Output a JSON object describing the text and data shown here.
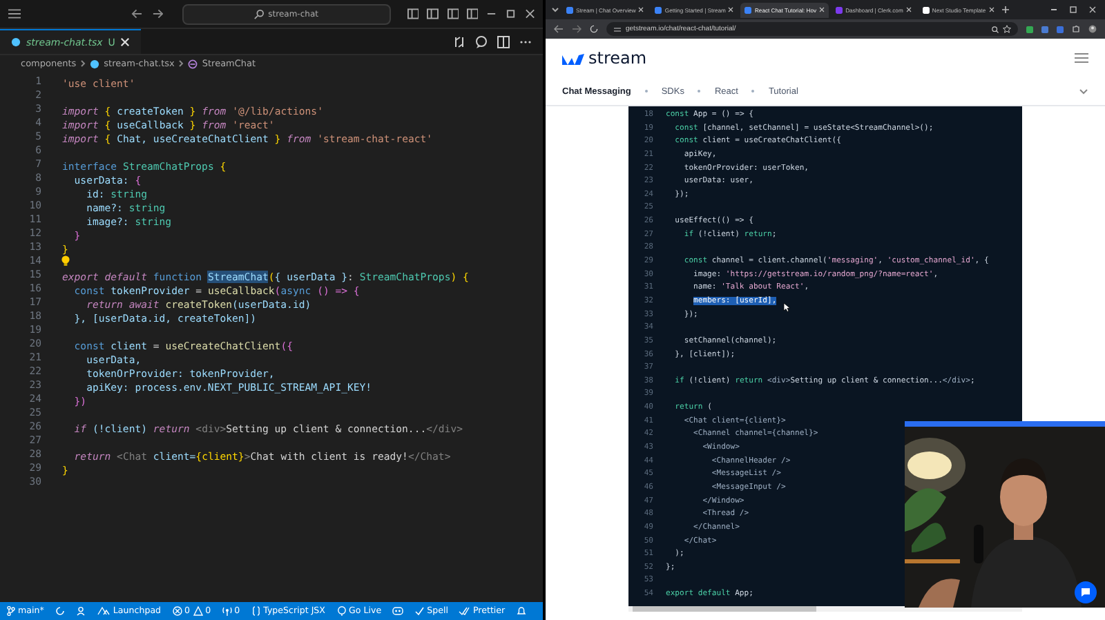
{
  "editor": {
    "search": "stream-chat",
    "tab": {
      "name": "stream-chat.tsx",
      "status": "U"
    },
    "breadcrumbs": [
      "components",
      "stream-chat.tsx",
      "StreamChat"
    ],
    "lines": [
      {
        "number": "1",
        "tokens": [
          {
            "text": "'use client'",
            "kind": "str"
          }
        ]
      },
      {
        "number": "2"
      },
      {
        "number": "3",
        "tokens": [
          {
            "text": "import ",
            "kind": "kw"
          },
          {
            "text": "{",
            "kind": "brace"
          },
          {
            "text": " createToken ",
            "kind": "var"
          },
          {
            "text": "}",
            "kind": "brace"
          },
          {
            "text": " from ",
            "kind": "kw"
          },
          {
            "text": "'@/lib/actions'",
            "kind": "str"
          }
        ]
      },
      {
        "number": "4",
        "tokens": [
          {
            "text": "import ",
            "kind": "kw"
          },
          {
            "text": "{",
            "kind": "brace"
          },
          {
            "text": " useCallback ",
            "kind": "var"
          },
          {
            "text": "}",
            "kind": "brace"
          },
          {
            "text": " from ",
            "kind": "kw"
          },
          {
            "text": "'react'",
            "kind": "str"
          }
        ]
      },
      {
        "number": "5",
        "tokens": [
          {
            "text": "import ",
            "kind": "kw"
          },
          {
            "text": "{",
            "kind": "brace"
          },
          {
            "text": " Chat, useCreateChatClient ",
            "kind": "var"
          },
          {
            "text": "}",
            "kind": "brace"
          },
          {
            "text": " from ",
            "kind": "kw"
          },
          {
            "text": "'stream-chat-react'",
            "kind": "str"
          }
        ]
      },
      {
        "number": "6"
      },
      {
        "number": "7",
        "tokens": [
          {
            "text": "interface ",
            "kind": "decl"
          },
          {
            "text": "StreamChatProps ",
            "kind": "type"
          },
          {
            "text": "{",
            "kind": "brace"
          }
        ]
      },
      {
        "number": "8",
        "tokens": [
          {
            "text": "  userData: ",
            "kind": "var"
          },
          {
            "text": "{",
            "kind": "brace2"
          }
        ]
      },
      {
        "number": "9",
        "tokens": [
          {
            "text": "    id: ",
            "kind": "var"
          },
          {
            "text": "string",
            "kind": "type"
          }
        ]
      },
      {
        "number": "10",
        "tokens": [
          {
            "text": "    name?: ",
            "kind": "var"
          },
          {
            "text": "string",
            "kind": "type"
          }
        ]
      },
      {
        "number": "11",
        "tokens": [
          {
            "text": "    image?: ",
            "kind": "var"
          },
          {
            "text": "string",
            "kind": "type"
          }
        ]
      },
      {
        "number": "12",
        "tokens": [
          {
            "text": "  }",
            "kind": "brace2"
          }
        ]
      },
      {
        "number": "13",
        "tokens": [
          {
            "text": "}",
            "kind": "brace"
          }
        ]
      },
      {
        "number": "14"
      },
      {
        "number": "15",
        "tokens": [
          {
            "text": "export default ",
            "kind": "kw"
          },
          {
            "text": "function ",
            "kind": "decl"
          },
          {
            "text": "StreamChat",
            "kind": "sel"
          },
          {
            "text": "(",
            "kind": "brace"
          },
          {
            "text": "{ userData }",
            "kind": "var"
          },
          {
            "text": ": ",
            "kind": "punct"
          },
          {
            "text": "StreamChatProps",
            "kind": "type"
          },
          {
            "text": ") {",
            "kind": "brace"
          }
        ]
      },
      {
        "number": "16",
        "tokens": [
          {
            "text": "  const ",
            "kind": "decl"
          },
          {
            "text": "tokenProvider ",
            "kind": "var"
          },
          {
            "text": "= ",
            "kind": "punct"
          },
          {
            "text": "useCallback",
            "kind": "fn"
          },
          {
            "text": "(",
            "kind": "brace2"
          },
          {
            "text": "async ",
            "kind": "decl"
          },
          {
            "text": "() => {",
            "kind": "brace2"
          }
        ]
      },
      {
        "number": "17",
        "tokens": [
          {
            "text": "    return await ",
            "kind": "kw"
          },
          {
            "text": "createToken",
            "kind": "fn"
          },
          {
            "text": "(userData.id)",
            "kind": "var"
          }
        ]
      },
      {
        "number": "18",
        "tokens": [
          {
            "text": "  }, [userData.id, createToken])",
            "kind": "var"
          }
        ]
      },
      {
        "number": "19"
      },
      {
        "number": "20",
        "tokens": [
          {
            "text": "  const ",
            "kind": "decl"
          },
          {
            "text": "client ",
            "kind": "var"
          },
          {
            "text": "= ",
            "kind": "punct"
          },
          {
            "text": "useCreateChatClient",
            "kind": "fn"
          },
          {
            "text": "({",
            "kind": "brace2"
          }
        ]
      },
      {
        "number": "21",
        "tokens": [
          {
            "text": "    userData,",
            "kind": "var"
          }
        ]
      },
      {
        "number": "22",
        "tokens": [
          {
            "text": "    tokenOrProvider: tokenProvider,",
            "kind": "var"
          }
        ]
      },
      {
        "number": "23",
        "tokens": [
          {
            "text": "    apiKey: process.env.NEXT_PUBLIC_STREAM_API_KEY!",
            "kind": "var"
          }
        ]
      },
      {
        "number": "24",
        "tokens": [
          {
            "text": "  })",
            "kind": "brace2"
          }
        ]
      },
      {
        "number": "25"
      },
      {
        "number": "26",
        "tokens": [
          {
            "text": "  if ",
            "kind": "kw"
          },
          {
            "text": "(!client) ",
            "kind": "var"
          },
          {
            "text": "return ",
            "kind": "kw"
          },
          {
            "text": "<div>",
            "kind": "tag"
          },
          {
            "text": "Setting up client & connection...",
            "kind": "punct"
          },
          {
            "text": "</div>",
            "kind": "tag"
          }
        ]
      },
      {
        "number": "27"
      },
      {
        "number": "28",
        "tokens": [
          {
            "text": "  return ",
            "kind": "kw"
          },
          {
            "text": "<Chat ",
            "kind": "tag"
          },
          {
            "text": "client=",
            "kind": "var"
          },
          {
            "text": "{client}",
            "kind": "brace"
          },
          {
            "text": ">",
            "kind": "tag"
          },
          {
            "text": "Chat with client is ready!",
            "kind": "punct"
          },
          {
            "text": "</Chat>",
            "kind": "tag"
          }
        ]
      },
      {
        "number": "29",
        "tokens": [
          {
            "text": "}",
            "kind": "brace"
          }
        ]
      },
      {
        "number": "30"
      }
    ]
  },
  "status_bar": {
    "branch": "main*",
    "launchpad": "Launchpad",
    "errors": "0",
    "warnings": "0",
    "ports": "0",
    "language": "TypeScript JSX",
    "go_live": "Go Live",
    "spell": "Spell",
    "prettier": "Prettier"
  },
  "browser": {
    "tabs": [
      {
        "title": "Stream | Chat Overview",
        "selected": false
      },
      {
        "title": "Getting Started | Stream",
        "selected": false
      },
      {
        "title": "React Chat Tutorial: Hov",
        "selected": true
      },
      {
        "title": "Dashboard | Clerk.com",
        "selected": false
      },
      {
        "title": "Next Studio Template",
        "selected": false
      }
    ],
    "address": "getstream.io/chat/react-chat/tutorial/",
    "logo": "stream",
    "nav": [
      "Chat Messaging",
      "SDKs",
      "React",
      "Tutorial"
    ],
    "code_lines": [
      {
        "number": "18",
        "tokens": [
          {
            "text": "const ",
            "kind": "kw"
          },
          {
            "text": "App = () => {",
            "kind": "plain"
          }
        ]
      },
      {
        "number": "19",
        "tokens": [
          {
            "text": "  const ",
            "kind": "kw"
          },
          {
            "text": "[channel, setChannel] = useState<StreamChannel>();",
            "kind": "plain"
          }
        ]
      },
      {
        "number": "20",
        "tokens": [
          {
            "text": "  const ",
            "kind": "kw"
          },
          {
            "text": "client = useCreateChatClient({",
            "kind": "plain"
          }
        ]
      },
      {
        "number": "21",
        "tokens": [
          {
            "text": "    apiKey,",
            "kind": "plain"
          }
        ]
      },
      {
        "number": "22",
        "tokens": [
          {
            "text": "    tokenOrProvider: userToken,",
            "kind": "plain"
          }
        ]
      },
      {
        "number": "23",
        "tokens": [
          {
            "text": "    userData: user,",
            "kind": "plain"
          }
        ]
      },
      {
        "number": "24",
        "tokens": [
          {
            "text": "  });",
            "kind": "plain"
          }
        ]
      },
      {
        "number": "25"
      },
      {
        "number": "26",
        "tokens": [
          {
            "text": "  useEffect(() => {",
            "kind": "plain"
          }
        ]
      },
      {
        "number": "27",
        "tokens": [
          {
            "text": "    if ",
            "kind": "kw"
          },
          {
            "text": "(!client) ",
            "kind": "plain"
          },
          {
            "text": "return",
            "kind": "kw"
          },
          {
            "text": ";",
            "kind": "plain"
          }
        ]
      },
      {
        "number": "28"
      },
      {
        "number": "29",
        "tokens": [
          {
            "text": "    const ",
            "kind": "kw"
          },
          {
            "text": "channel = client.channel(",
            "kind": "plain"
          },
          {
            "text": "'messaging'",
            "kind": "str"
          },
          {
            "text": ", ",
            "kind": "plain"
          },
          {
            "text": "'custom_channel_id'",
            "kind": "str"
          },
          {
            "text": ", {",
            "kind": "plain"
          }
        ]
      },
      {
        "number": "30",
        "tokens": [
          {
            "text": "      image: ",
            "kind": "plain"
          },
          {
            "text": "'https://getstream.io/random_png/?name=react'",
            "kind": "str"
          },
          {
            "text": ",",
            "kind": "plain"
          }
        ]
      },
      {
        "number": "31",
        "tokens": [
          {
            "text": "      name: ",
            "kind": "plain"
          },
          {
            "text": "'Talk about React'",
            "kind": "str"
          },
          {
            "text": ",",
            "kind": "plain"
          }
        ]
      },
      {
        "number": "32",
        "tokens": [
          {
            "text": "      members: [userId],",
            "kind": "sel"
          }
        ]
      },
      {
        "number": "33",
        "tokens": [
          {
            "text": "    });",
            "kind": "plain"
          }
        ]
      },
      {
        "number": "34"
      },
      {
        "number": "35",
        "tokens": [
          {
            "text": "    setChannel(channel);",
            "kind": "plain"
          }
        ]
      },
      {
        "number": "36",
        "tokens": [
          {
            "text": "  }, [client]);",
            "kind": "plain"
          }
        ]
      },
      {
        "number": "37"
      },
      {
        "number": "38",
        "tokens": [
          {
            "text": "  if ",
            "kind": "kw"
          },
          {
            "text": "(!client) ",
            "kind": "plain"
          },
          {
            "text": "return ",
            "kind": "kw"
          },
          {
            "text": "<div>",
            "kind": "tag"
          },
          {
            "text": "Setting up client & connection...",
            "kind": "plain"
          },
          {
            "text": "</div>",
            "kind": "tag"
          },
          {
            "text": ";",
            "kind": "plain"
          }
        ]
      },
      {
        "number": "39"
      },
      {
        "number": "40",
        "tokens": [
          {
            "text": "  return ",
            "kind": "kw"
          },
          {
            "text": "(",
            "kind": "plain"
          }
        ]
      },
      {
        "number": "41",
        "tokens": [
          {
            "text": "    <Chat client={client}>",
            "kind": "tag"
          }
        ]
      },
      {
        "number": "42",
        "tokens": [
          {
            "text": "      <Channel channel={channel}>",
            "kind": "tag"
          }
        ]
      },
      {
        "number": "43",
        "tokens": [
          {
            "text": "        <Window>",
            "kind": "tag"
          }
        ]
      },
      {
        "number": "44",
        "tokens": [
          {
            "text": "          <ChannelHeader />",
            "kind": "tag"
          }
        ]
      },
      {
        "number": "45",
        "tokens": [
          {
            "text": "          <MessageList />",
            "kind": "tag"
          }
        ]
      },
      {
        "number": "46",
        "tokens": [
          {
            "text": "          <MessageInput />",
            "kind": "tag"
          }
        ]
      },
      {
        "number": "47",
        "tokens": [
          {
            "text": "        </Window>",
            "kind": "tag"
          }
        ]
      },
      {
        "number": "48",
        "tokens": [
          {
            "text": "        <Thread />",
            "kind": "tag"
          }
        ]
      },
      {
        "number": "49",
        "tokens": [
          {
            "text": "      </Channel>",
            "kind": "tag"
          }
        ]
      },
      {
        "number": "50",
        "tokens": [
          {
            "text": "    </Chat>",
            "kind": "tag"
          }
        ]
      },
      {
        "number": "51",
        "tokens": [
          {
            "text": "  );",
            "kind": "plain"
          }
        ]
      },
      {
        "number": "52",
        "tokens": [
          {
            "text": "};",
            "kind": "plain"
          }
        ]
      },
      {
        "number": "53"
      },
      {
        "number": "54",
        "tokens": [
          {
            "text": "export default ",
            "kind": "kw"
          },
          {
            "text": "App;",
            "kind": "plain"
          }
        ]
      }
    ],
    "video": {
      "kind": "picture"
    }
  }
}
